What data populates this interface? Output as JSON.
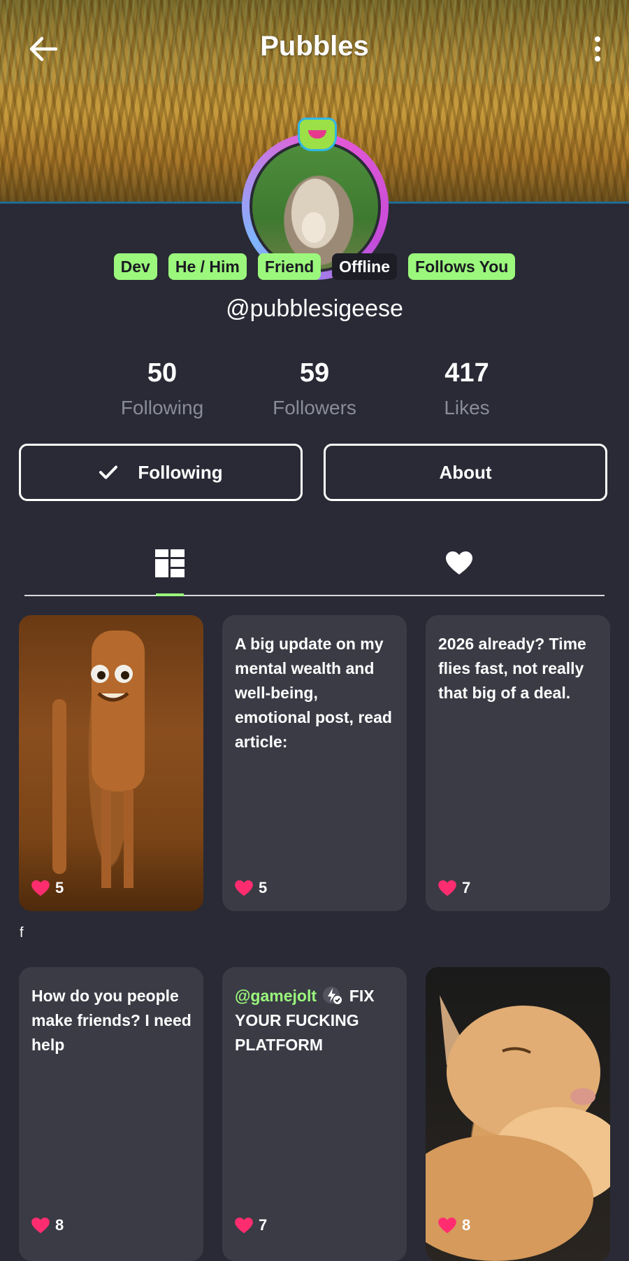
{
  "header": {
    "title": "Pubbles",
    "back_icon": "arrow-left-icon",
    "more_icon": "more-vertical-icon"
  },
  "profile": {
    "tags": [
      "Dev",
      "He / Him",
      "Friend",
      "Offline",
      "Follows You"
    ],
    "handle": "@pubblesigeese",
    "stats": [
      {
        "value": "50",
        "label": "Following"
      },
      {
        "value": "59",
        "label": "Followers"
      },
      {
        "value": "417",
        "label": "Likes"
      }
    ]
  },
  "actions": {
    "following_label": "Following",
    "about_label": "About"
  },
  "tabs": {
    "posts_icon": "grid-icon",
    "likes_icon": "heart-icon"
  },
  "posts": [
    {
      "text": "",
      "likes": "5",
      "kind": "image"
    },
    {
      "text": "A big update on my mental wealth and well-being, emotional post, read article:",
      "likes": "5",
      "kind": "text"
    },
    {
      "text": "2026 already? Time flies fast, not really that big of a deal.",
      "likes": "7",
      "kind": "text"
    },
    {
      "text": "How do you people make friends? I need help",
      "likes": "8",
      "kind": "text"
    },
    {
      "mention": "@gamejolt",
      "text": "FIX YOUR FUCKING PLATFORM",
      "likes": "7",
      "kind": "text"
    },
    {
      "text": "",
      "likes": "8",
      "kind": "image"
    }
  ],
  "stray_text": "f",
  "colors": {
    "background": "#292a35",
    "card": "#3a3b45",
    "accent": "#9bf87c",
    "heart": "#ff2d6f"
  }
}
